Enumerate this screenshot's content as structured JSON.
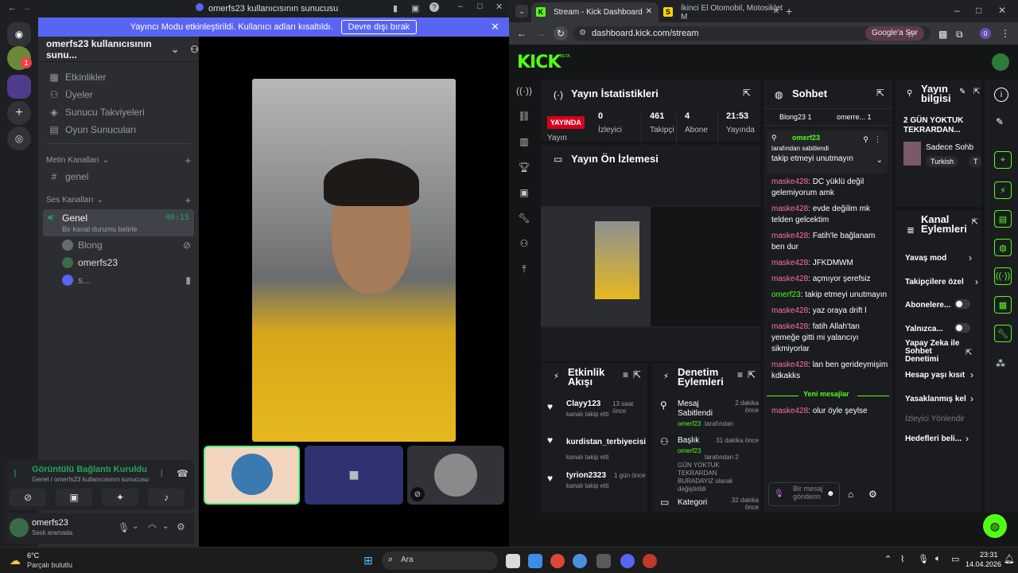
{
  "discord": {
    "window_title": "omerfs23 kullanıcısının sunucusu",
    "banner_text": "Yayıncı Modu etkinleştirildi. Kullanıcı adları kısaltıldı.",
    "banner_button": "Devre dışı bırak",
    "server_name": "omerfs23 kullanıcısının sunu...",
    "menu": [
      "Etkinlikler",
      "Üyeler",
      "Sunucu Takviyeleri",
      "Oyun Sunucuları"
    ],
    "text_category": "Metin Kanalları",
    "text_channel": "genel",
    "voice_category": "Ses Kanalları",
    "voice_channel": "Genel",
    "voice_time": "40:15",
    "voice_status": "Bir kanal durumu belirle",
    "voice_members": [
      "Blong",
      "omerfs23",
      "s..."
    ],
    "connection_title": "Görüntülü Bağlantı Kuruldu",
    "connection_sub": "Genel / omerfs23 kullanıcısının sunucusu",
    "user_name": "omerfs23",
    "user_status": "Sesli aramada",
    "notif_count": "1"
  },
  "chrome": {
    "tab1": "Stream - Kick Dashboard",
    "tab2": "İkinci El Otomobil, Motosiklet M",
    "url": "dashboard.kick.com/stream",
    "google_btn": "Google'a Sor",
    "profile": "0"
  },
  "kick": {
    "logo": "KICK",
    "logo_sup": "BETA",
    "stats_title": "Yayın İstatistikleri",
    "live_badge": "YAYINDA",
    "live_label": "Yayın",
    "stats": [
      {
        "value": "0",
        "label": "İzleyici"
      },
      {
        "value": "461",
        "label": "Takipçi"
      },
      {
        "value": "4",
        "label": "Abone"
      },
      {
        "value": "21:53",
        "label": "Yayında"
      }
    ],
    "preview_title": "Yayın Ön İzlemesi",
    "chat_title": "Sohbet",
    "chat_tabs": [
      "Blong23 1",
      "omerre... 1"
    ],
    "pinned_user": "omerf23",
    "pinned_by": "tarafından sabitlendi",
    "pinned_msg": "takip etmeyi unutmayın",
    "messages": [
      {
        "u": "maske428",
        "t": ": DC yüklü değil gelemiyorum amk"
      },
      {
        "u": "maske428",
        "t": ": evde değilim mk telden gelcektim"
      },
      {
        "u": "maske428",
        "t": ": Fatih'le bağlanam ben dur"
      },
      {
        "u": "maske428",
        "t": ": JFKDMWM"
      },
      {
        "u": "maske428",
        "t": ": açmıyor şerefsiz"
      },
      {
        "u": "omerf23",
        "t": ": takip etmeyi unutmayın"
      },
      {
        "u": "maske428",
        "t": ": yaz oraya drift l"
      },
      {
        "u": "maske428",
        "t": ": fatih Allah'tan yemeğe gitti mi yalancıyı sikmiyorlar"
      },
      {
        "u": "maske428",
        "t": ": lan ben gerideymişim kdkakks"
      }
    ],
    "new_messages": "Yeni mesajlar",
    "last_message": {
      "u": "maske428",
      "t": ": olur öyle şeylse"
    },
    "send_placeholder": "Bir mesaj gönderin",
    "info_title": "Yayın bilgisi",
    "info_stream_title": "2 GÜN YOKTUK TEKRARDAN...",
    "info_category": "Sadece Sohb",
    "info_tag": "Turkish",
    "info_tag2": "T",
    "activity_title": "Etkinlik Akışı",
    "activity": [
      {
        "name": "Clayy123",
        "time": "13 saat önce",
        "desc": "kanalı takip etti"
      },
      {
        "name": "kurdistan_terbiyecisi",
        "time": "",
        "desc": "kanalı takip etti"
      },
      {
        "name": "tyrion2323",
        "time": "1 gün önce",
        "desc": "kanalı takip etti"
      }
    ],
    "mod_title": "Denetim Eylemleri",
    "mod": [
      {
        "title": "Mesaj Sabitlendi",
        "time": "2 dakika önce",
        "by": "omerf23",
        "rest": "tarafından"
      },
      {
        "title": "Başlık",
        "time": "31 dakika önce",
        "by": "omerf23",
        "rest": "tarafından 2 GÜN YOKTUK TEKRARDAN BURADAYIZ olarak değiştirildi"
      },
      {
        "title": "Kategori",
        "time": "32 dakika önce",
        "by": "",
        "rest": ""
      }
    ],
    "channel_actions_title": "Kanal Eylemleri",
    "channel_actions": [
      "Yavaş mod",
      "Takipçilere özel",
      "Abonelere...",
      "Yalnızca...",
      "Yapay Zeka ile Sohbet Denetimi",
      "Hesap yaşı kısıt",
      "Yasaklanmış kel",
      "İzleyici Yönlendir",
      "Hedefleri beli..."
    ]
  },
  "taskbar": {
    "weather_temp": "6°C",
    "weather_desc": "Parçalı bulutlu",
    "search": "Ara",
    "time": "23:31",
    "date": "14.04.2026"
  }
}
